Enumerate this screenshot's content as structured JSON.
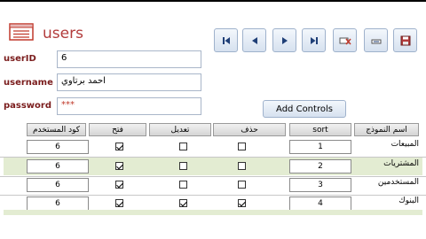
{
  "form": {
    "title": "users",
    "fields": {
      "userID": {
        "label": "userID",
        "value": "6"
      },
      "username": {
        "label": "username",
        "value": "احمد برتاوي"
      },
      "password": {
        "label": "password",
        "value": "***"
      }
    },
    "add_controls_label": "Add Controls",
    "nav_icons": [
      "first-record-icon",
      "previous-record-icon",
      "next-record-icon",
      "last-record-icon",
      "delete-record-icon",
      "new-record-icon",
      "save-record-icon"
    ]
  },
  "grid": {
    "headers": {
      "form_name": "اسم النموذج",
      "sort": "sort",
      "delete": "حذف",
      "edit": "تعديل",
      "open": "فتح",
      "user_code": "كود المستخدم"
    },
    "rows": [
      {
        "form_name": "المبيعات",
        "sort": "1",
        "delete": false,
        "edit": false,
        "open": true,
        "user_code": "6"
      },
      {
        "form_name": "المشتريات",
        "sort": "2",
        "delete": false,
        "edit": false,
        "open": true,
        "user_code": "6"
      },
      {
        "form_name": "المستخدمين",
        "sort": "3",
        "delete": false,
        "edit": false,
        "open": true,
        "user_code": "6"
      },
      {
        "form_name": "البنوك",
        "sort": "4",
        "delete": true,
        "edit": true,
        "open": true,
        "user_code": "6"
      }
    ]
  },
  "colors": {
    "title": "#b23b3b",
    "label": "#7a1c1c",
    "row_alt": "#e3ecd2"
  }
}
